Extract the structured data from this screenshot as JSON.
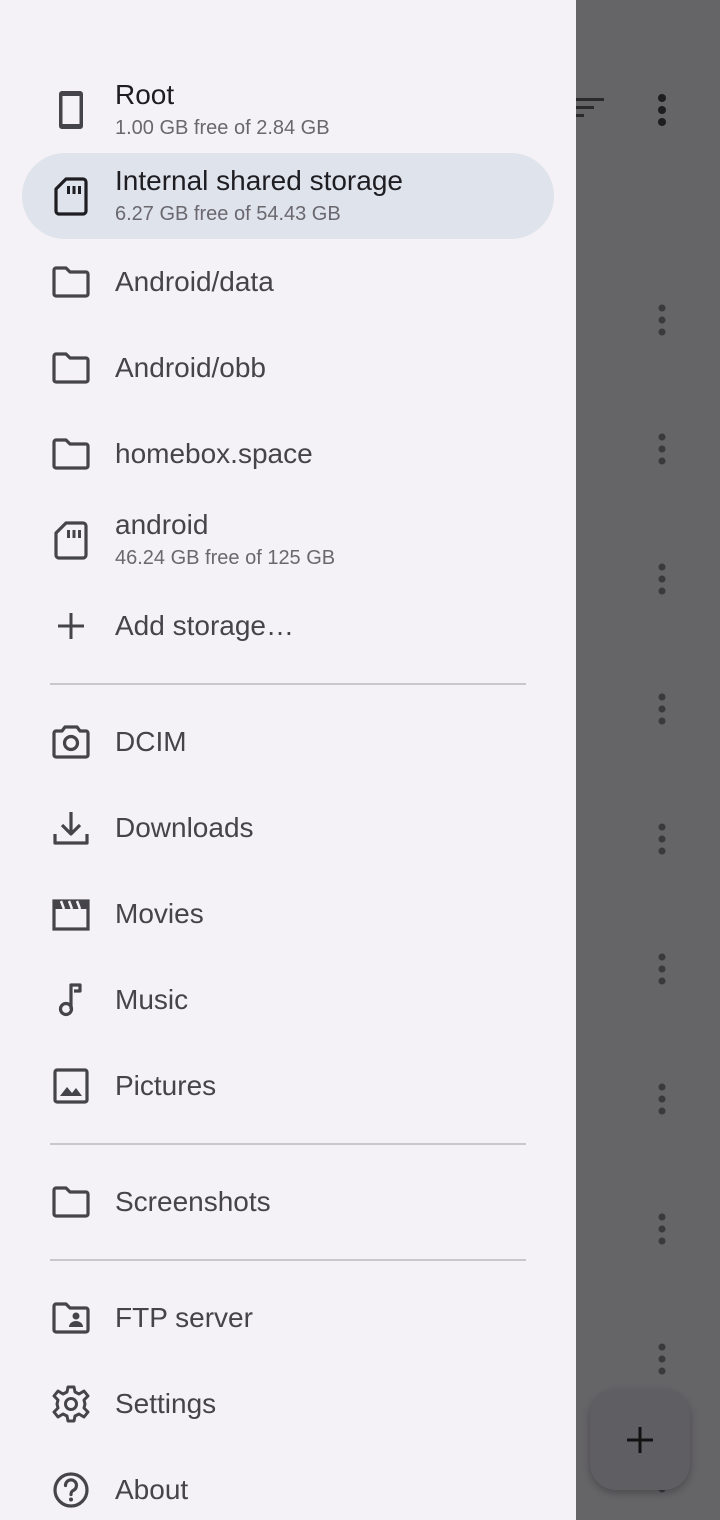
{
  "drawer": {
    "storage_items": [
      {
        "label": "Root",
        "subtitle": "1.00 GB free of 2.84 GB",
        "icon": "phone-icon",
        "selected": false
      },
      {
        "label": "Internal shared storage",
        "subtitle": "6.27 GB free of 54.43 GB",
        "icon": "sd-card-icon",
        "selected": true
      },
      {
        "label": "Android/data",
        "icon": "folder-icon"
      },
      {
        "label": "Android/obb",
        "icon": "folder-icon"
      },
      {
        "label": "homebox.space",
        "icon": "folder-icon"
      },
      {
        "label": "android",
        "subtitle": "46.24 GB free of 125 GB",
        "icon": "sd-card-icon"
      },
      {
        "label": "Add storage…",
        "icon": "plus-icon"
      }
    ],
    "standard_dirs": [
      {
        "label": "DCIM",
        "icon": "camera-icon"
      },
      {
        "label": "Downloads",
        "icon": "download-icon"
      },
      {
        "label": "Movies",
        "icon": "movie-icon"
      },
      {
        "label": "Music",
        "icon": "music-note-icon"
      },
      {
        "label": "Pictures",
        "icon": "image-icon"
      }
    ],
    "bookmarks": [
      {
        "label": "Screenshots",
        "icon": "folder-icon"
      }
    ],
    "app_items": [
      {
        "label": "FTP server",
        "icon": "folder-shared-icon"
      },
      {
        "label": "Settings",
        "icon": "gear-icon"
      },
      {
        "label": "About",
        "icon": "help-circle-icon"
      }
    ]
  },
  "colors": {
    "drawer_bg": "#f4f2f6",
    "selected_bg": "#dfe3ec",
    "scrim": "#656466",
    "icon": "#45444a"
  }
}
